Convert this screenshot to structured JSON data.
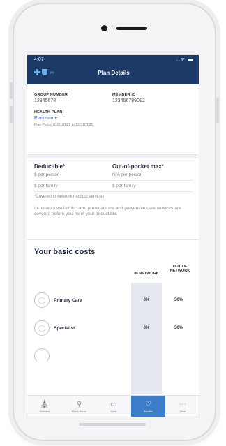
{
  "status_bar": {
    "time": "4:07",
    "icons": "..ᯤ ▬"
  },
  "header": {
    "logo_tm": "(R)",
    "title": "Plan Details"
  },
  "member": {
    "group_label": "GROUP NUMBER",
    "group_value": "12345678",
    "member_label": "MEMBER ID",
    "member_value": "123456789012",
    "plan_label": "HEALTH PLAN",
    "plan_value": "Plan name",
    "plan_period": "Plan Period 01/01/2021  to 12/31/2021"
  },
  "costs": {
    "deductible_title": "Deductible*",
    "oop_title": "Out-of-pocket max*",
    "deductible_person": "$ per person",
    "oop_person": "N/A per person",
    "deductible_family": "$ per family",
    "oop_family": "$ per family",
    "footnote": "*Covered in-network medical services",
    "preventive_note": "In-network well-child care, prenatal care and preventive care services are covered before you meet your deductible."
  },
  "basic_costs": {
    "title": "Your basic costs",
    "in_network_header": "IN NETWORK",
    "out_network_header": "OUT OF NETWORK",
    "services": [
      {
        "name": "Primary Care",
        "in_network": "0%",
        "out_network": "50%"
      },
      {
        "name": "Specialist",
        "in_network": "0%",
        "out_network": "50%"
      }
    ]
  },
  "tabs": [
    {
      "label": "Overview",
      "icon": "building-icon",
      "active": false
    },
    {
      "label": "Find a Doctor",
      "icon": "location-pin-icon",
      "active": false
    },
    {
      "label": "Costs",
      "icon": "receipt-icon",
      "active": false
    },
    {
      "label": "Benefits",
      "icon": "heart-icon",
      "active": true
    },
    {
      "label": "More",
      "icon": "more-icon",
      "active": false
    }
  ],
  "colors": {
    "header": "#1c3a66",
    "accent": "#3d7dc9",
    "link": "#3b73c4"
  }
}
